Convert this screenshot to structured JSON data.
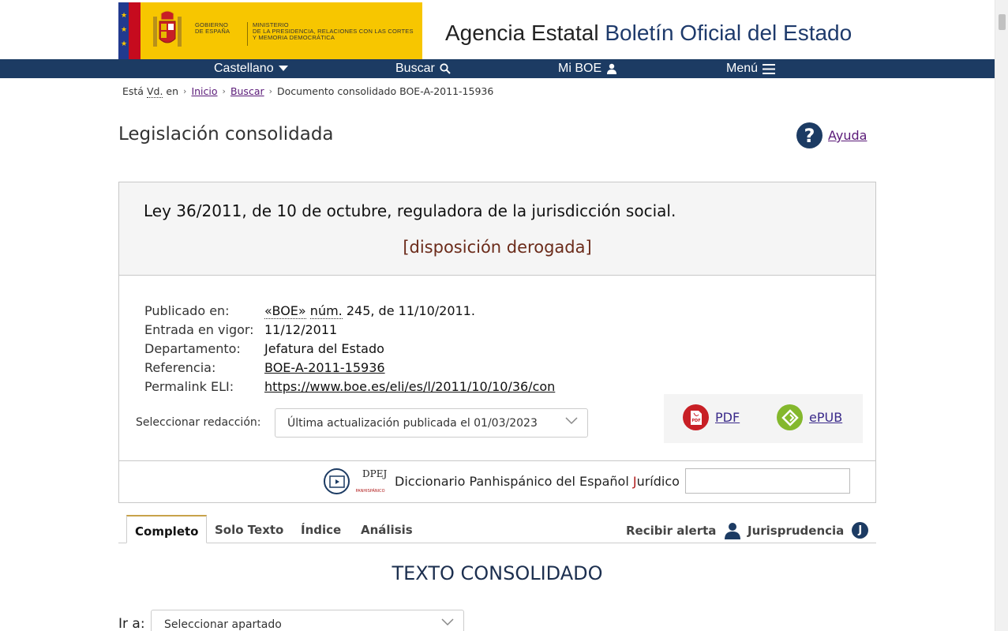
{
  "header": {
    "gov_text_line1": "GOBIERNO",
    "gov_text_line2": "DE ESPAÑA",
    "ministry_line1": "MINISTERIO",
    "ministry_line2": "DE LA PRESIDENCIA, RELACIONES CON LAS CORTES",
    "ministry_line3": "Y MEMORIA DEMOCRÁTICA",
    "agency_prefix": "Agencia Estatal",
    "agency_name": "Boletín Oficial del Estado",
    "brand_color": "#1c3b63",
    "logo_color": "#f7c600"
  },
  "nav": {
    "language": "Castellano",
    "search": "Buscar",
    "my_boe": "Mi BOE",
    "menu": "Menú"
  },
  "breadcrumb": {
    "prefix": "Está",
    "abbr": "Vd.",
    "en": "en",
    "home": "Inicio",
    "search": "Buscar",
    "current": "Documento consolidado BOE-A-2011-15936"
  },
  "page": {
    "title": "Legislación consolidada",
    "help": "Ayuda"
  },
  "document": {
    "title": "Ley 36/2011, de 10 de octubre, reguladora de la jurisdicción social.",
    "status": "[disposición derogada]",
    "meta": {
      "published_label": "Publicado en:",
      "published_boe": "«BOE»",
      "published_num": "núm.",
      "published_rest": "245, de 11/10/2011.",
      "effective_label": "Entrada en vigor:",
      "effective_value": "11/12/2011",
      "department_label": "Departamento:",
      "department_value": "Jefatura del Estado",
      "reference_label": "Referencia:",
      "reference_value": "BOE-A-2011-15936",
      "eli_label": "Permalink ELI:",
      "eli_value": "https://www.boe.es/eli/es/l/2011/10/10/36/con"
    },
    "version_label": "Seleccionar redacción:",
    "version_value": "Última actualización publicada el 01/03/2023",
    "pdf": "PDF",
    "epub": "ePUB",
    "dict_label_pre": "Diccionario Panhispánico del Español ",
    "dict_label_j": "J",
    "dict_label_post": "urídico",
    "dpej_logo_letters": "DPEJ",
    "dpej_logo_sub": "PANHISPÁNICO"
  },
  "tabs": {
    "complete": "Completo",
    "text_only": "Solo Texto",
    "index": "Índice",
    "analysis": "Análisis",
    "alert": "Recibir alerta",
    "jurisprudence": "Jurisprudencia",
    "j_badge": "J"
  },
  "content": {
    "heading": "TEXTO CONSOLIDADO",
    "goto_label": "Ir a:",
    "goto_placeholder": "Seleccionar apartado"
  }
}
